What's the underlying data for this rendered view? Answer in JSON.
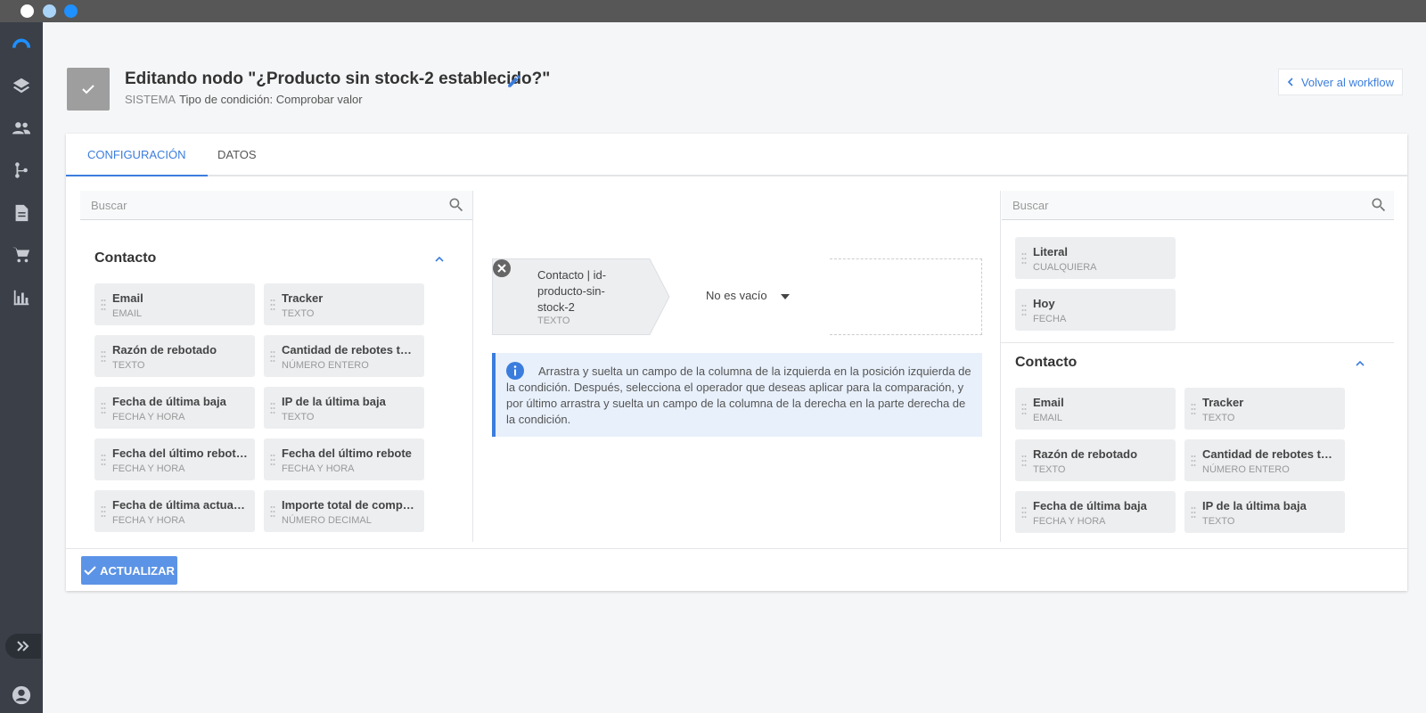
{
  "colors": {
    "titlebar": "#575757",
    "sidebar": "#3a3f48",
    "accent": "#3b7ddd",
    "dot_1": "#ffffff",
    "dot_2": "#a9d4f7",
    "dot_3": "#1e90ff"
  },
  "sidebar": {
    "items": [
      {
        "icon": "logo-icon"
      },
      {
        "icon": "layers-icon"
      },
      {
        "icon": "people-icon"
      },
      {
        "icon": "workflow-icon"
      },
      {
        "icon": "document-icon"
      },
      {
        "icon": "cart-icon"
      },
      {
        "icon": "bar-chart-icon"
      }
    ],
    "expand_icon": "expand-icon",
    "user_icon": "user-icon"
  },
  "header": {
    "title": "Editando nodo \"¿Producto sin stock-2 establecido?\"",
    "system_label": "SISTEMA",
    "condition_type": "Tipo de condición: Comprobar valor",
    "back_label": "Volver al workflow"
  },
  "tabs": [
    {
      "label": "Configuración",
      "active": true
    },
    {
      "label": "Datos",
      "active": false
    }
  ],
  "left_panel": {
    "search_placeholder": "Buscar",
    "section_title": "Contacto",
    "fields": [
      {
        "name": "Email",
        "type": "Email"
      },
      {
        "name": "Tracker",
        "type": "Texto"
      },
      {
        "name": "Razón de rebotado",
        "type": "Texto"
      },
      {
        "name": "Cantidad de rebotes temporales",
        "type": "Número entero"
      },
      {
        "name": "Fecha de última baja",
        "type": "Fecha y hora"
      },
      {
        "name": "IP de la última baja",
        "type": "Texto"
      },
      {
        "name": "Fecha del último rebote temporal",
        "type": "Fecha y hora"
      },
      {
        "name": "Fecha del último rebote",
        "type": "Fecha y hora"
      },
      {
        "name": "Fecha de última actualización",
        "type": "Fecha y hora"
      },
      {
        "name": "Importe total de compras",
        "type": "Número decimal"
      }
    ]
  },
  "condition": {
    "field_name": "Contacto | id-producto-sin-stock-2",
    "field_type": "Texto",
    "operator": "No es vacío"
  },
  "info": {
    "text": "Arrastra y suelta un campo de la columna de la izquierda en la posición izquierda de la condición. Después, selecciona el operador que deseas aplicar para la comparación, y por último arrastra y suelta un campo de la columna de la derecha en la parte derecha de la condición."
  },
  "right_panel": {
    "search_placeholder": "Buscar",
    "literals": [
      {
        "name": "Literal",
        "type": "Cualquiera"
      },
      {
        "name": "Hoy",
        "type": "Fecha"
      }
    ],
    "section_title": "Contacto",
    "fields": [
      {
        "name": "Email",
        "type": "Email"
      },
      {
        "name": "Tracker",
        "type": "Texto"
      },
      {
        "name": "Razón de rebotado",
        "type": "Texto"
      },
      {
        "name": "Cantidad de rebotes temporales",
        "type": "Número entero"
      },
      {
        "name": "Fecha de última baja",
        "type": "Fecha y hora"
      },
      {
        "name": "IP de la última baja",
        "type": "Texto"
      }
    ]
  },
  "footer": {
    "update_label": "ACTUALIZAR"
  }
}
